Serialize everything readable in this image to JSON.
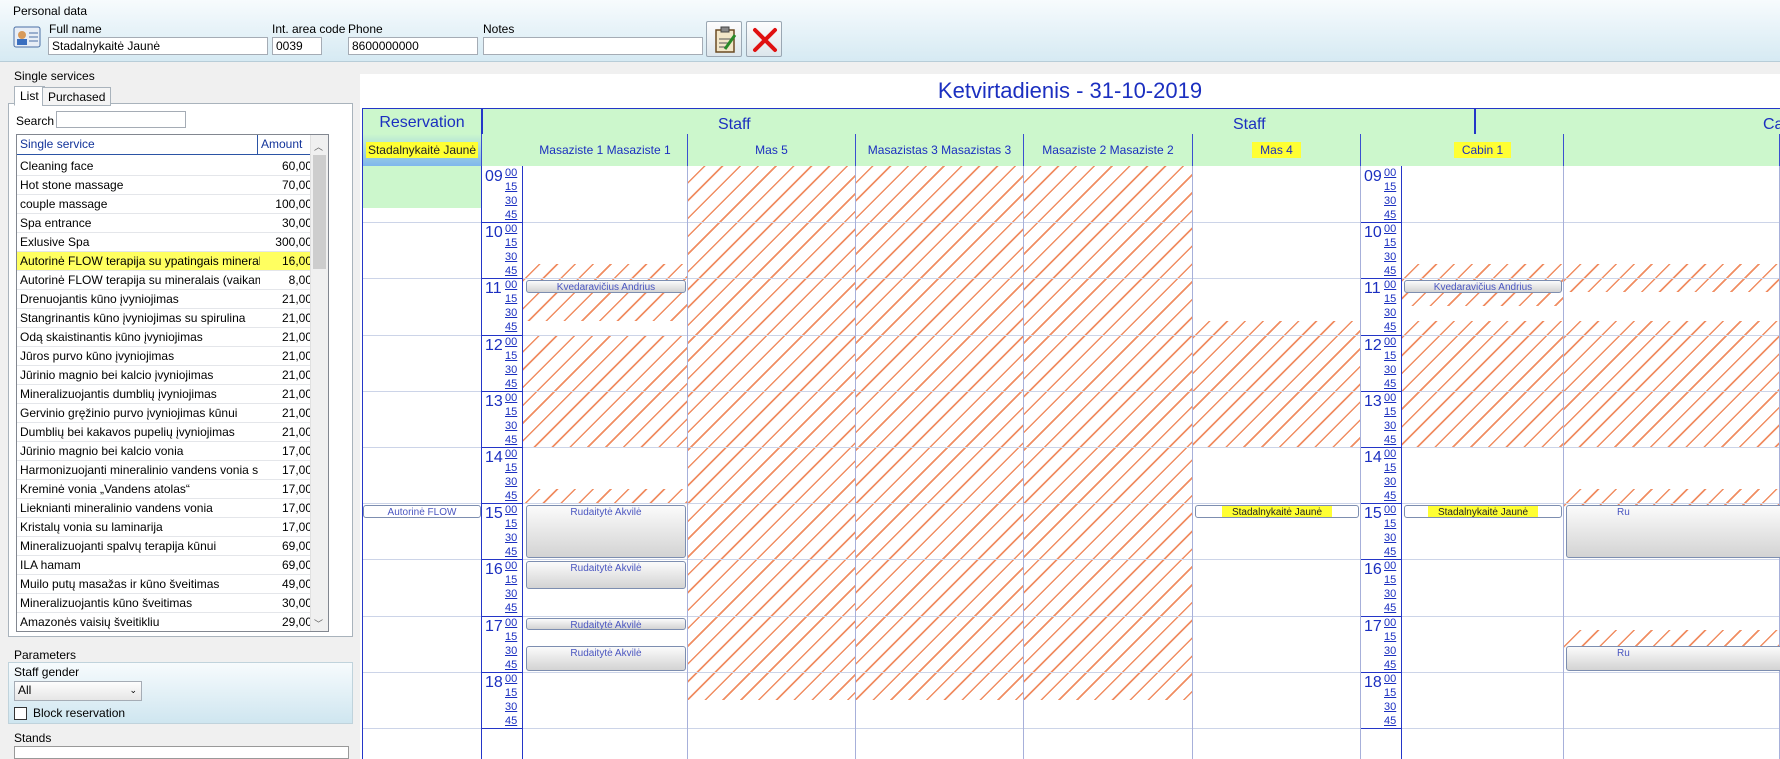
{
  "personal": {
    "title": "Personal data",
    "full_name_label": "Full name",
    "full_name": "Stadalnykaitė Jaunė",
    "area_label": "Int. area code",
    "area": "0039",
    "phone_label": "Phone",
    "phone": "8600000000",
    "notes_label": "Notes",
    "notes": ""
  },
  "services": {
    "title": "Single services",
    "tabs": [
      "List",
      "Purchased"
    ],
    "search_label": "Search",
    "col_service": "Single service",
    "col_amount": "Amount",
    "rows": [
      [
        "Cleaning face",
        "60,00"
      ],
      [
        "Hot stone massage",
        "70,00"
      ],
      [
        "couple massage",
        "100,00"
      ],
      [
        "Spa entrance",
        "30,00"
      ],
      [
        "Exlusive Spa",
        "300,00"
      ],
      [
        "Autorinė FLOW terapija su ypatingais mineral",
        "16,00"
      ],
      [
        "Autorinė FLOW terapija su mineralais (vaikam",
        "8,00"
      ],
      [
        "Drenuojantis kūno įvyniojimas",
        "21,00"
      ],
      [
        "Stangrinantis kūno įvyniojimas su spirulina",
        "21,00"
      ],
      [
        "Odą skaistinantis kūno įvyniojimas",
        "21,00"
      ],
      [
        "Jūros purvo kūno įvyniojimas",
        "21,00"
      ],
      [
        "Jūrinio magnio bei kalcio įvyniojimas",
        "21,00"
      ],
      [
        "Mineralizuojantis dumblių įvyniojimas",
        "21,00"
      ],
      [
        "Gervinio gręžinio purvo įvyniojimas kūnui",
        "21,00"
      ],
      [
        "Dumblių bei kakavos pupelių įvyniojimas",
        "21,00"
      ],
      [
        "Jūrinio magnio bei kalcio vonia",
        "17,00"
      ],
      [
        "Harmonizuojanti mineralinio vandens vonia s",
        "17,00"
      ],
      [
        "Kreminė vonia „Vandens atolas“",
        "17,00"
      ],
      [
        "Lieknianti mineralinio vandens vonia",
        "17,00"
      ],
      [
        "Kristalų vonia su laminarija",
        "17,00"
      ],
      [
        "Mineralizuojanti spalvų terapija kūnui",
        "69,00"
      ],
      [
        "ILA hamam",
        "69,00"
      ],
      [
        "Muilo putų masažas ir kūno šveitimas",
        "49,00"
      ],
      [
        "Mineralizuojantis kūno šveitimas",
        "30,00"
      ],
      [
        "Amazonės vaisių šveitikliu",
        "29,00"
      ]
    ],
    "highlight_index": 5
  },
  "parameters": {
    "title": "Parameters",
    "gender_label": "Staff gender",
    "gender_value": "All",
    "block_label": "Block reservation",
    "stands_label": "Stands"
  },
  "calendar": {
    "day_title": "Ketvirtadienis - 31-10-2019",
    "group_reservation": "Reservation",
    "group_staff": "Staff",
    "group_staff2": "Staff",
    "group_cabins": "Ca",
    "col_client": "Stadalnykaitė Jaunė",
    "staff_cols": [
      "Masaziste 1 Masaziste 1",
      "Mas 5",
      "Masazistas 3 Masazistas 3",
      "Masaziste 2 Masaziste 2",
      "Mas 4"
    ],
    "cabin_cols": [
      "Cabin 1"
    ],
    "hours": [
      "09",
      "10",
      "11",
      "12",
      "13",
      "14",
      "15",
      "16",
      "17",
      "18"
    ],
    "minutes": [
      "00",
      "15",
      "30",
      "45"
    ],
    "appts": {
      "kvedaravicius": "Kvedaravičius Andrius",
      "rudaityte": "Rudaitytė Akvilė",
      "stadalnykaite": "Stadalnykaitė Jaunė",
      "autorine": "Autorinė FLOW",
      "ru": "Ru"
    }
  }
}
